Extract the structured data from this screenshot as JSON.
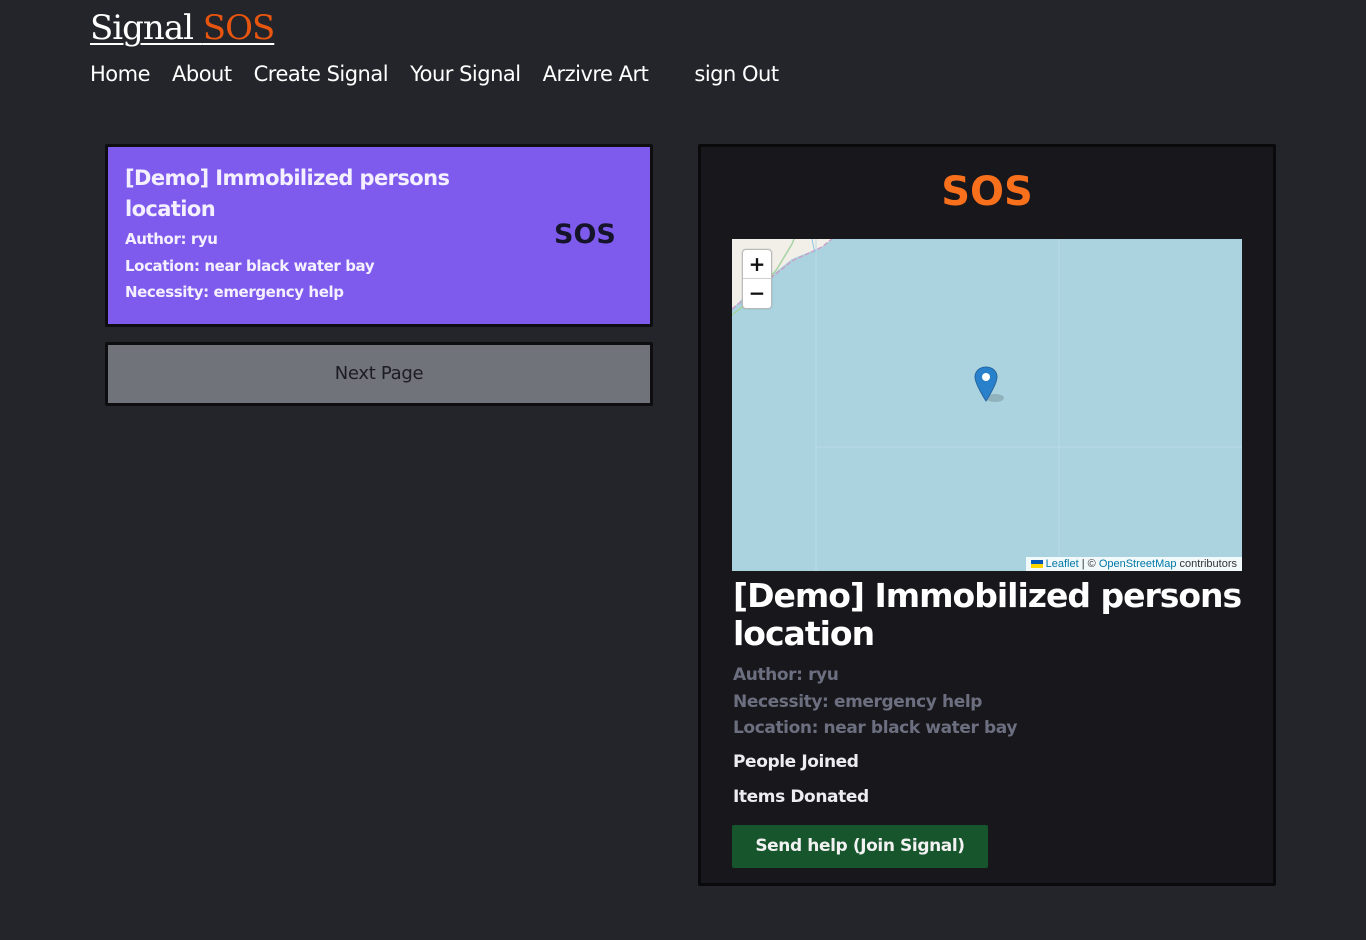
{
  "header": {
    "brand_main": "Signal",
    "brand_accent": "SOS",
    "nav": [
      "Home",
      "About",
      "Create Signal",
      "Your Signal",
      "Arzivre Art",
      "sign Out"
    ]
  },
  "signal_list": {
    "items": [
      {
        "title": "[Demo] Immobilized persons location",
        "author": "Author: ryu",
        "location": "Location: near black water bay",
        "necessity": "Necessity: emergency help",
        "badge": "SOS"
      }
    ],
    "next_page_label": "Next Page"
  },
  "detail": {
    "heading": "SOS",
    "title": "[Demo] Immobilized persons location",
    "author": "Author: ryu",
    "necessity": "Necessity: emergency help",
    "location": "Location: near black water bay",
    "people_joined_label": "People Joined",
    "items_donated_label": "Items Donated",
    "join_button_label": "Send help (Join Signal)",
    "map": {
      "zoom_in": "+",
      "zoom_out": "−",
      "attribution_leaflet": "Leaflet",
      "attribution_sep": " | © ",
      "attribution_osm": "OpenStreetMap",
      "attribution_suffix": " contributors"
    }
  },
  "colors": {
    "background": "#24252a",
    "brand_accent": "#e8550f",
    "card_purple": "#7e5bed",
    "sos_orange": "#f9701c",
    "join_green": "#17552c",
    "map_water": "#aad3df"
  }
}
